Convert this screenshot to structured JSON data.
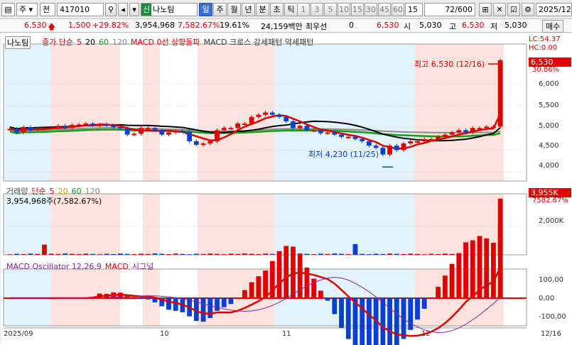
{
  "toolbar": {
    "market_type": "주",
    "exchange": "전",
    "code": "417010",
    "badge": "신",
    "name": "나노팀",
    "periods": [
      "일",
      "주",
      "월",
      "년",
      "분",
      "초",
      "틱"
    ],
    "active_period": "일",
    "minute_buttons": [
      "1",
      "3",
      "5",
      "10",
      "15",
      "30",
      "45",
      "60"
    ],
    "interval": "15",
    "count": "72/600",
    "date": "2025/12/"
  },
  "quote": {
    "price": "6,530",
    "change": "1,500",
    "change_rate": "+29.82%",
    "volume": "3,954,968",
    "volume_rate": "7,582.67%",
    "turnover_rate": "19.61%",
    "amount": "24,159백만",
    "priority_label": "최우선",
    "priority_value": "0",
    "ask": "6,530",
    "open_label": "시",
    "open": "5,030",
    "high_label": "고",
    "high": "6,530",
    "low_label": "저",
    "low": "5,030",
    "action": "매수"
  },
  "panels": {
    "price_title": "나노팀",
    "price_legend": [
      {
        "text": "종가 단순",
        "color": "#e00000"
      },
      {
        "text": "5",
        "color": "#e00000"
      },
      {
        "text": "20",
        "color": "#000000"
      },
      {
        "text": "60",
        "color": "#12a012"
      },
      {
        "text": "120",
        "color": "#888888"
      },
      {
        "text": "MACD 0선 상향돌파",
        "color": "#e00000"
      },
      {
        "text": "MACD 크로스 강세패턴  약세패턴",
        "color": "#333333"
      }
    ],
    "lc_label": "LC:54.37",
    "hc_label": "HC:0.00",
    "high_note": "최고 6,530 (12/16)",
    "low_note": "최저 4,230 (11/25)",
    "last_price_tag": "6,530",
    "last_pct_tag": "30.86%",
    "price_ticks": [
      "6,000",
      "5,500",
      "5,000",
      "4,500",
      "4,000"
    ],
    "volume_legend": [
      {
        "text": "거래량",
        "color": "#555555"
      },
      {
        "text": "단순",
        "color": "#e00000"
      },
      {
        "text": "5",
        "color": "#e00000"
      },
      {
        "text": "20",
        "color": "#c8a000"
      },
      {
        "text": "60",
        "color": "#12a012"
      },
      {
        "text": "120",
        "color": "#888888"
      }
    ],
    "volume_value": "3,954,968주(7,582.67%)",
    "volume_tag": "3,955K",
    "volume_pct_tag": "7582.67%",
    "volume_ticks": [
      "2,000K"
    ],
    "macd_legend": [
      {
        "text": "MACD Oscillator 12,26,9",
        "color": "#9020a0"
      },
      {
        "text": "MACD",
        "color": "#e00000"
      },
      {
        "text": "시그널",
        "color": "#9020a0"
      }
    ],
    "macd_ticks": [
      "100,00",
      "0,00",
      "-100,00"
    ],
    "date_labels": [
      "2025/09",
      "10",
      "11",
      "12",
      "12/16"
    ]
  },
  "chart_data": {
    "type": "candlestick",
    "ylim": [
      3800,
      6900
    ],
    "high_point": {
      "date": "12/16",
      "value": 6530
    },
    "low_point": {
      "date": "11/25",
      "value": 4230
    },
    "close": [
      4980,
      4900,
      5020,
      4950,
      4990,
      5000,
      5010,
      5050,
      5000,
      5070,
      5080,
      5100,
      5060,
      5080,
      5060,
      5020,
      4990,
      4850,
      4870,
      5000,
      5000,
      4950,
      4850,
      4900,
      4930,
      4920,
      4700,
      4620,
      4650,
      4700,
      4950,
      5000,
      5000,
      5100,
      5100,
      5250,
      5300,
      5350,
      5300,
      5250,
      5150,
      5000,
      5050,
      4950,
      4950,
      4880,
      4900,
      4850,
      4800,
      4800,
      4750,
      4700,
      4600,
      4550,
      4400,
      4600,
      4500,
      4650,
      4700,
      4700,
      4750,
      4750,
      4800,
      4850,
      4900,
      4950,
      4900,
      5000,
      5000,
      5030,
      5030,
      6530
    ],
    "volume_spikes": [
      {
        "index": 5,
        "value": 720
      },
      {
        "index": 50,
        "value": 760
      },
      {
        "index": 71,
        "value": 3955
      }
    ],
    "volume_unit": "K"
  },
  "colors": {
    "up": "#e00000",
    "down": "#0b3fd0",
    "shade_pink": "#fde3dd",
    "shade_blue": "#e3f3fd"
  }
}
